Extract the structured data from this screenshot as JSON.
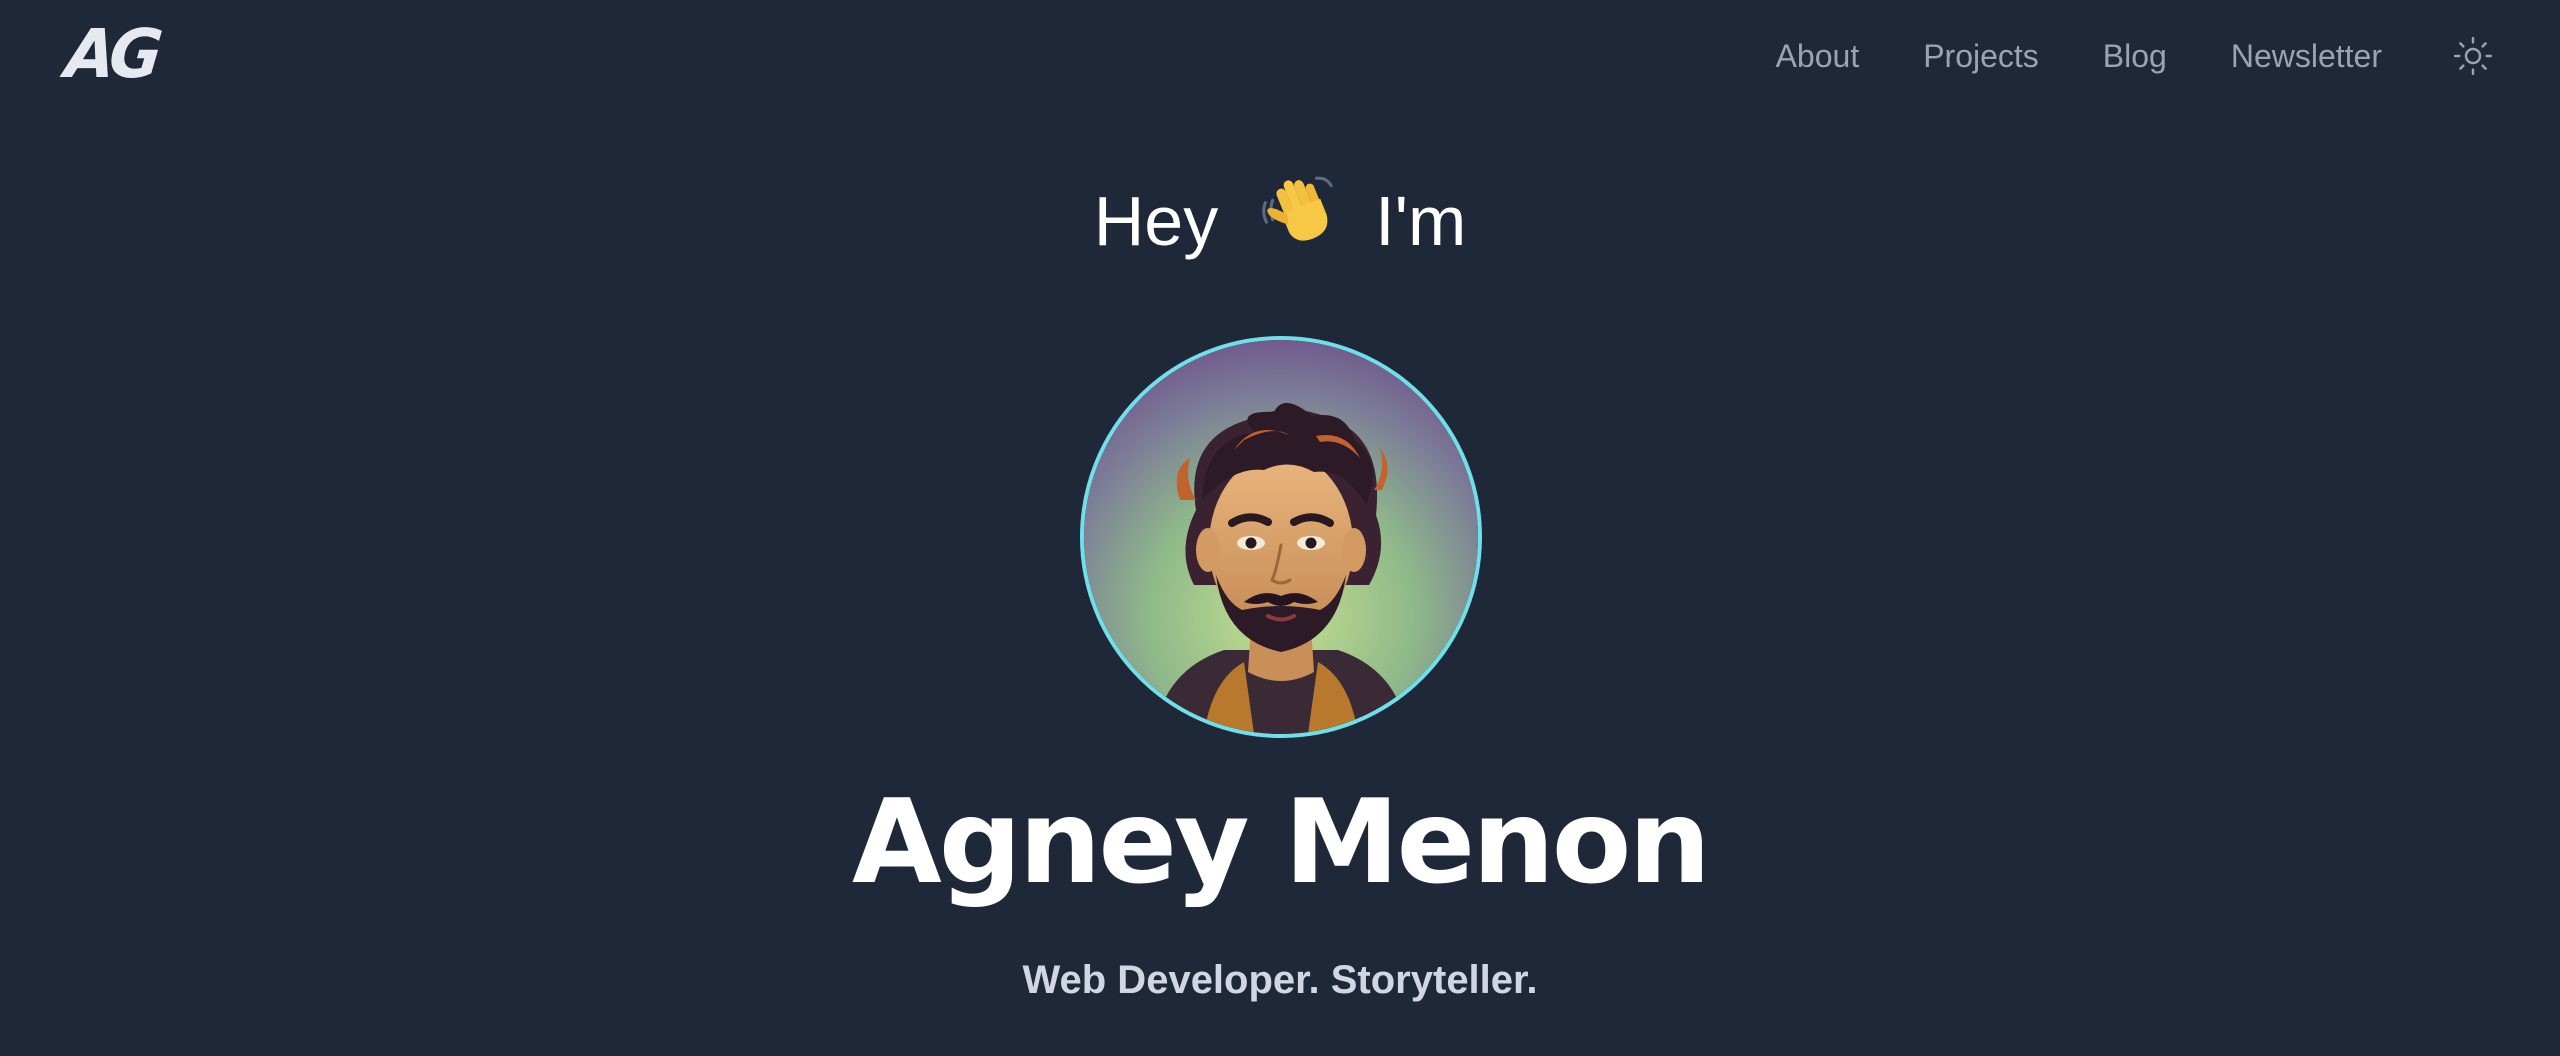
{
  "header": {
    "logo_text": "AG",
    "nav": [
      {
        "label": "About"
      },
      {
        "label": "Projects"
      },
      {
        "label": "Blog"
      },
      {
        "label": "Newsletter"
      }
    ],
    "theme_toggle_icon": "sun-icon"
  },
  "hero": {
    "greeting_before": "Hey",
    "greeting_emoji_icon": "waving-hand-icon",
    "greeting_after": "I'm",
    "avatar_icon": "illustrated-portrait-avatar",
    "name": "Agney Menon",
    "tagline": "Web Developer. Storyteller."
  },
  "colors": {
    "background": "#1f2839",
    "nav_text": "#9aa3b2",
    "avatar_border": "#6fe0ea",
    "heading": "#ffffff"
  }
}
